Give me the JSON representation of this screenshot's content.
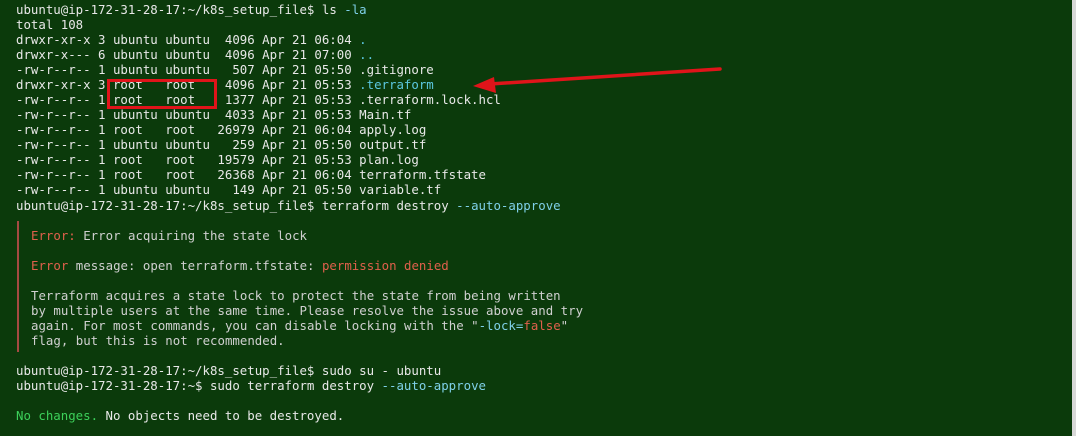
{
  "terminal": {
    "prompt1": "ubuntu@ip-172-31-28-17:~/k8s_setup_file$",
    "cmd_ls": "ls",
    "cmd_ls_flag": "-la",
    "total": "total 108",
    "listing": [
      {
        "meta": "drwxr-xr-x 3 ubuntu ubuntu  4096 Apr 21 06:04 ",
        "name": ".",
        "kind": "dir"
      },
      {
        "meta": "drwxr-x--- 6 ubuntu ubuntu  4096 Apr 21 07:00 ",
        "name": "..",
        "kind": "dir"
      },
      {
        "meta": "-rw-r--r-- 1 ubuntu ubuntu   507 Apr 21 05:50 ",
        "name": ".gitignore",
        "kind": "file"
      },
      {
        "meta": "drwxr-xr-x 3 root   root    4096 Apr 21 05:53 ",
        "name": ".terraform",
        "kind": "dir"
      },
      {
        "meta": "-rw-r--r-- 1 root   root    1377 Apr 21 05:53 ",
        "name": ".terraform.lock.hcl",
        "kind": "file"
      },
      {
        "meta": "-rw-r--r-- 1 ubuntu ubuntu  4033 Apr 21 05:53 ",
        "name": "Main.tf",
        "kind": "file"
      },
      {
        "meta": "-rw-r--r-- 1 root   root   26979 Apr 21 06:04 ",
        "name": "apply.log",
        "kind": "file"
      },
      {
        "meta": "-rw-r--r-- 1 ubuntu ubuntu   259 Apr 21 05:50 ",
        "name": "output.tf",
        "kind": "file"
      },
      {
        "meta": "-rw-r--r-- 1 root   root   19579 Apr 21 05:53 ",
        "name": "plan.log",
        "kind": "file"
      },
      {
        "meta": "-rw-r--r-- 1 root   root   26368 Apr 21 06:04 ",
        "name": "terraform.tfstate",
        "kind": "file"
      },
      {
        "meta": "-rw-r--r-- 1 ubuntu ubuntu   149 Apr 21 05:50 ",
        "name": "variable.tf",
        "kind": "file"
      }
    ],
    "cmd_destroy": "terraform destroy",
    "flag_auto": "--auto-approve",
    "err_label": "Error:",
    "err_title": " Error acquiring the state lock",
    "err2_label": "Error",
    "err2_text": " message: open terraform.tfstate: ",
    "err2_perm": "permission denied",
    "detail": [
      "Terraform acquires a state lock to protect the state from being written",
      "by multiple users at the same time. Please resolve the issue above and try"
    ],
    "detail3_a": "again. For most commands, you can disable locking with the \"",
    "detail3_b": "-lock=",
    "detail3_c": "false",
    "detail3_d": "\"",
    "detail4": "flag, but this is not recommended.",
    "cmd_sudo_su": " sudo su - ubuntu",
    "prompt2": "ubuntu@ip-172-31-28-17:~$",
    "cmd_sudo_tf": " sudo terraform destroy ",
    "nochange_a": "No changes.",
    "nochange_b": " No objects need to be destroyed."
  },
  "annotation": {
    "color": "#e0141a"
  },
  "colors": {
    "background": "#0b3a0b",
    "text": "#e8e8e8",
    "dir": "#5cc8e0",
    "error": "#e0604c",
    "success": "#3cd05a"
  }
}
